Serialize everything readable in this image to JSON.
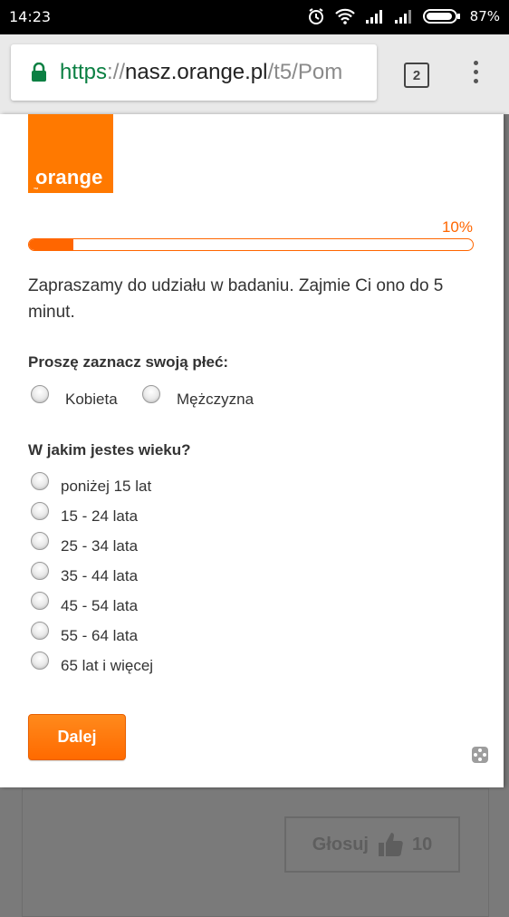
{
  "status_bar": {
    "time": "14:23",
    "battery": "87%",
    "icons": [
      "alarm-icon",
      "wifi-icon",
      "signal-icon",
      "signal-icon",
      "battery-icon"
    ]
  },
  "browser": {
    "url_scheme": "https",
    "url_sep": "://",
    "url_host": "nasz.orange.pl",
    "url_path": "/t5/Pom",
    "tab_count": "2",
    "colors": {
      "secure": "#0b8043"
    }
  },
  "survey": {
    "logo_text": "orange",
    "logo_tm": "™",
    "progress_label": "10%",
    "progress_value": 0.1,
    "intro": "Zapraszamy do udziału w badaniu. Zajmie Ci ono do 5 minut.",
    "q1": {
      "label": "Proszę zaznacz swoją płeć:",
      "options": [
        "Kobieta",
        "Mężczyzna"
      ]
    },
    "q2": {
      "label": "W jakim jestes wieku?",
      "options": [
        "poniżej 15 lat",
        "15 - 24 lata",
        "25 - 34 lata",
        "35 - 44 lata",
        "45 - 54 lata",
        "55 - 64 lata",
        "65 lat i więcej"
      ]
    },
    "next_label": "Dalej",
    "accent": "#ff6600"
  },
  "background": {
    "vote_label": "Głosuj",
    "vote_count": "10"
  }
}
